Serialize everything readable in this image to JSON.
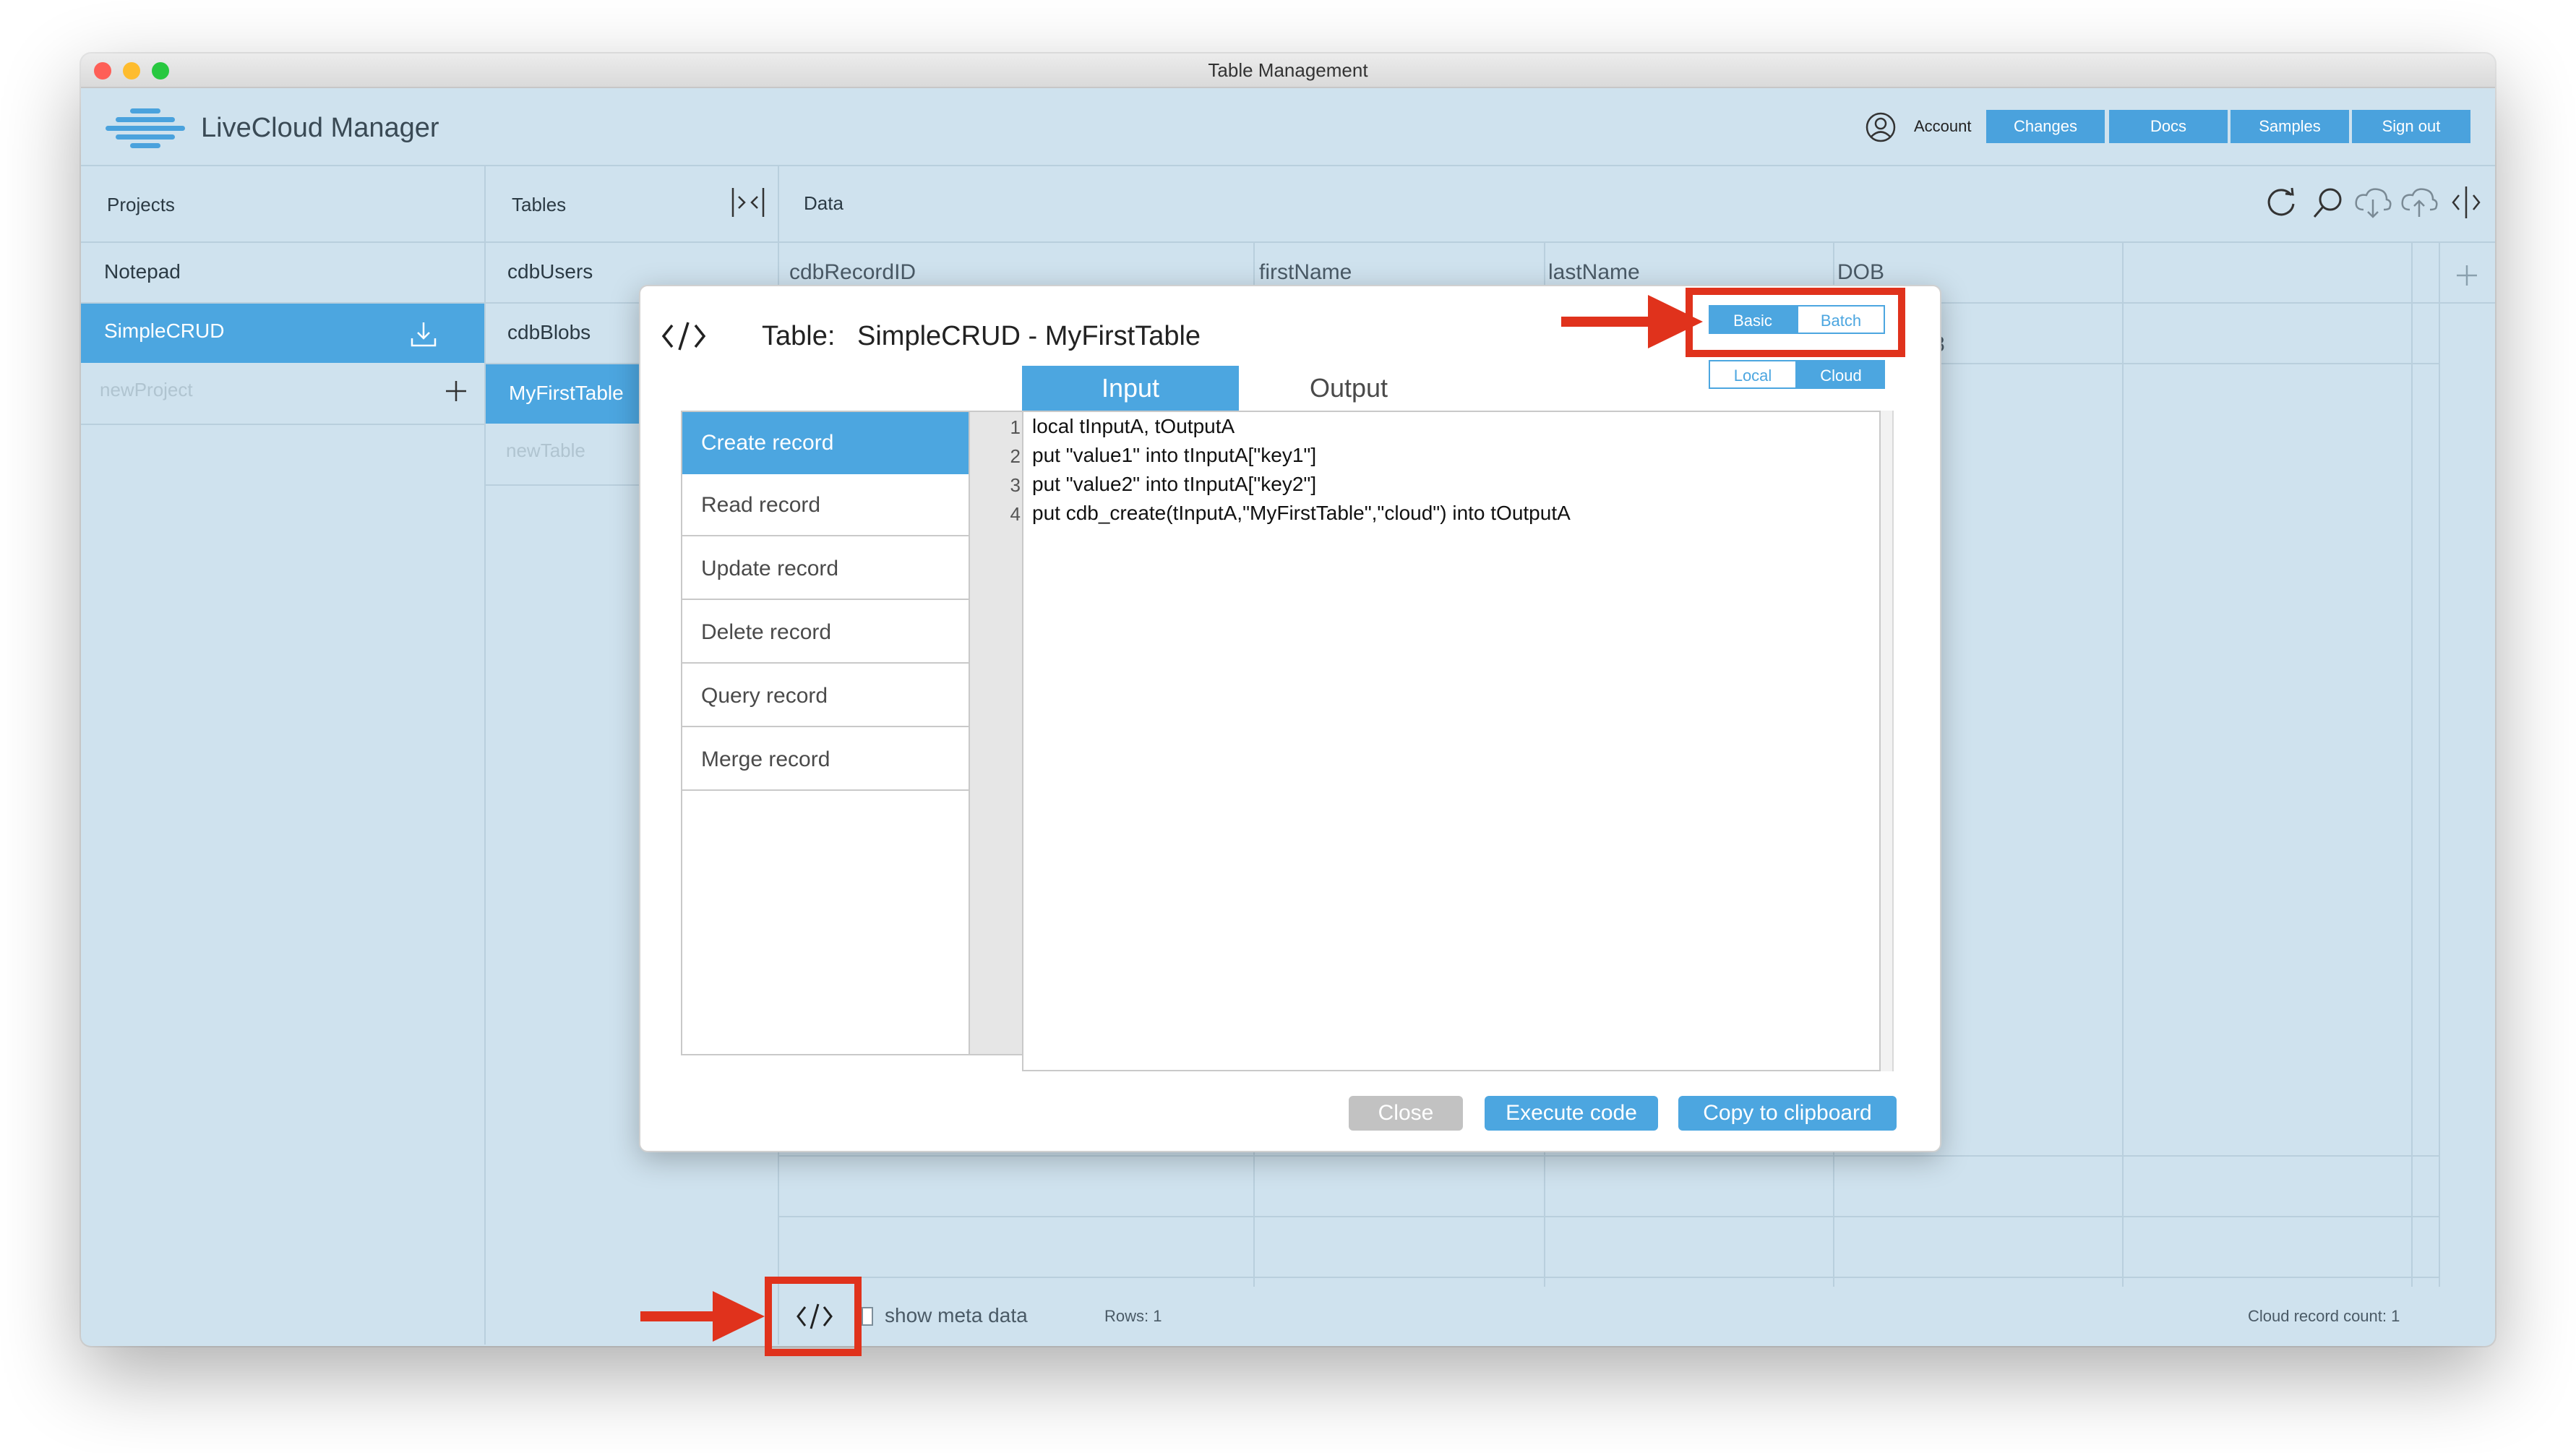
{
  "window": {
    "title": "Table Management"
  },
  "header": {
    "brand": "LiveCloud Manager",
    "account_label": "Account",
    "buttons": [
      "Changes",
      "Docs",
      "Samples",
      "Sign out"
    ]
  },
  "columns": {
    "projects": "Projects",
    "tables": "Tables",
    "data": "Data"
  },
  "projects": {
    "items": [
      "Notepad",
      "SimpleCRUD"
    ],
    "new_placeholder": "newProject"
  },
  "tables": {
    "items": [
      "cdbUsers",
      "cdbBlobs",
      "MyFirstTable"
    ],
    "new_placeholder": "newTable"
  },
  "grid": {
    "headers": [
      "cdbRecordID",
      "firstName",
      "lastName",
      "DOB"
    ],
    "partial_cell": "8"
  },
  "modal": {
    "table_label": "Table:",
    "table_name": "SimpleCRUD - MyFirstTable",
    "mode_toggle": {
      "options": [
        "Basic",
        "Batch"
      ],
      "selected": "Basic"
    },
    "target_toggle": {
      "options": [
        "Local",
        "Cloud"
      ],
      "selected": "Cloud"
    },
    "tabs": [
      "Input",
      "Output"
    ],
    "active_tab": "Input",
    "menu": [
      "Create record",
      "Read record",
      "Update record",
      "Delete record",
      "Query record",
      "Merge record"
    ],
    "selected_menu": "Create record",
    "code_lines": [
      "local tInputA, tOutputA",
      "put \"value1\" into tInputA[\"key1\"]",
      "put \"value2\" into tInputA[\"key2\"]",
      "put cdb_create(tInputA,\"MyFirstTable\",\"cloud\") into tOutputA"
    ],
    "line_numbers": [
      "1",
      "2",
      "3",
      "4"
    ],
    "buttons": {
      "close": "Close",
      "execute": "Execute code",
      "copy": "Copy to clipboard"
    }
  },
  "footer": {
    "show_meta": "show meta data",
    "rows": "Rows: 1",
    "cloud_count": "Cloud record count: 1"
  },
  "colors": {
    "accent": "#4ca6e0",
    "highlight": "#e0321c",
    "window_bg": "#cfe2ee"
  }
}
